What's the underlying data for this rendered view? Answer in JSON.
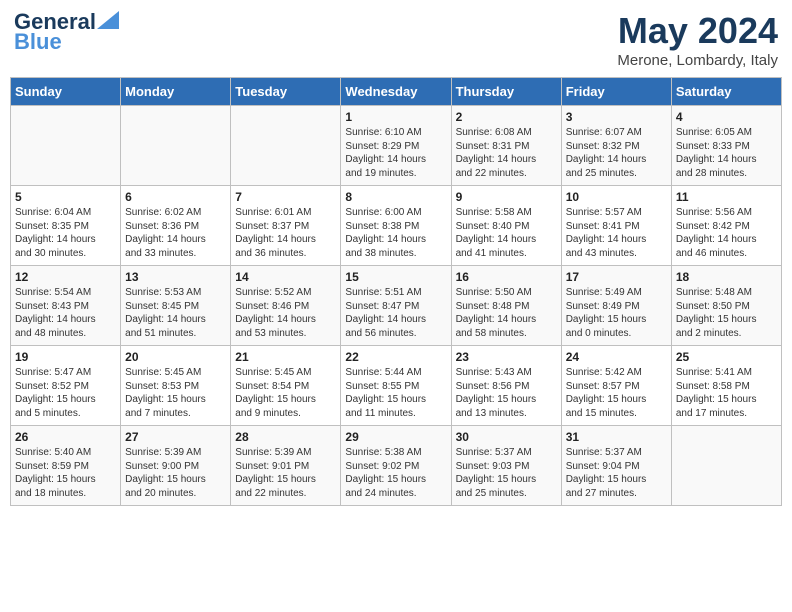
{
  "logo": {
    "general": "General",
    "blue": "Blue"
  },
  "title": "May 2024",
  "subtitle": "Merone, Lombardy, Italy",
  "days_of_week": [
    "Sunday",
    "Monday",
    "Tuesday",
    "Wednesday",
    "Thursday",
    "Friday",
    "Saturday"
  ],
  "weeks": [
    [
      {
        "day": "",
        "info": ""
      },
      {
        "day": "",
        "info": ""
      },
      {
        "day": "",
        "info": ""
      },
      {
        "day": "1",
        "info": "Sunrise: 6:10 AM\nSunset: 8:29 PM\nDaylight: 14 hours\nand 19 minutes."
      },
      {
        "day": "2",
        "info": "Sunrise: 6:08 AM\nSunset: 8:31 PM\nDaylight: 14 hours\nand 22 minutes."
      },
      {
        "day": "3",
        "info": "Sunrise: 6:07 AM\nSunset: 8:32 PM\nDaylight: 14 hours\nand 25 minutes."
      },
      {
        "day": "4",
        "info": "Sunrise: 6:05 AM\nSunset: 8:33 PM\nDaylight: 14 hours\nand 28 minutes."
      }
    ],
    [
      {
        "day": "5",
        "info": "Sunrise: 6:04 AM\nSunset: 8:35 PM\nDaylight: 14 hours\nand 30 minutes."
      },
      {
        "day": "6",
        "info": "Sunrise: 6:02 AM\nSunset: 8:36 PM\nDaylight: 14 hours\nand 33 minutes."
      },
      {
        "day": "7",
        "info": "Sunrise: 6:01 AM\nSunset: 8:37 PM\nDaylight: 14 hours\nand 36 minutes."
      },
      {
        "day": "8",
        "info": "Sunrise: 6:00 AM\nSunset: 8:38 PM\nDaylight: 14 hours\nand 38 minutes."
      },
      {
        "day": "9",
        "info": "Sunrise: 5:58 AM\nSunset: 8:40 PM\nDaylight: 14 hours\nand 41 minutes."
      },
      {
        "day": "10",
        "info": "Sunrise: 5:57 AM\nSunset: 8:41 PM\nDaylight: 14 hours\nand 43 minutes."
      },
      {
        "day": "11",
        "info": "Sunrise: 5:56 AM\nSunset: 8:42 PM\nDaylight: 14 hours\nand 46 minutes."
      }
    ],
    [
      {
        "day": "12",
        "info": "Sunrise: 5:54 AM\nSunset: 8:43 PM\nDaylight: 14 hours\nand 48 minutes."
      },
      {
        "day": "13",
        "info": "Sunrise: 5:53 AM\nSunset: 8:45 PM\nDaylight: 14 hours\nand 51 minutes."
      },
      {
        "day": "14",
        "info": "Sunrise: 5:52 AM\nSunset: 8:46 PM\nDaylight: 14 hours\nand 53 minutes."
      },
      {
        "day": "15",
        "info": "Sunrise: 5:51 AM\nSunset: 8:47 PM\nDaylight: 14 hours\nand 56 minutes."
      },
      {
        "day": "16",
        "info": "Sunrise: 5:50 AM\nSunset: 8:48 PM\nDaylight: 14 hours\nand 58 minutes."
      },
      {
        "day": "17",
        "info": "Sunrise: 5:49 AM\nSunset: 8:49 PM\nDaylight: 15 hours\nand 0 minutes."
      },
      {
        "day": "18",
        "info": "Sunrise: 5:48 AM\nSunset: 8:50 PM\nDaylight: 15 hours\nand 2 minutes."
      }
    ],
    [
      {
        "day": "19",
        "info": "Sunrise: 5:47 AM\nSunset: 8:52 PM\nDaylight: 15 hours\nand 5 minutes."
      },
      {
        "day": "20",
        "info": "Sunrise: 5:45 AM\nSunset: 8:53 PM\nDaylight: 15 hours\nand 7 minutes."
      },
      {
        "day": "21",
        "info": "Sunrise: 5:45 AM\nSunset: 8:54 PM\nDaylight: 15 hours\nand 9 minutes."
      },
      {
        "day": "22",
        "info": "Sunrise: 5:44 AM\nSunset: 8:55 PM\nDaylight: 15 hours\nand 11 minutes."
      },
      {
        "day": "23",
        "info": "Sunrise: 5:43 AM\nSunset: 8:56 PM\nDaylight: 15 hours\nand 13 minutes."
      },
      {
        "day": "24",
        "info": "Sunrise: 5:42 AM\nSunset: 8:57 PM\nDaylight: 15 hours\nand 15 minutes."
      },
      {
        "day": "25",
        "info": "Sunrise: 5:41 AM\nSunset: 8:58 PM\nDaylight: 15 hours\nand 17 minutes."
      }
    ],
    [
      {
        "day": "26",
        "info": "Sunrise: 5:40 AM\nSunset: 8:59 PM\nDaylight: 15 hours\nand 18 minutes."
      },
      {
        "day": "27",
        "info": "Sunrise: 5:39 AM\nSunset: 9:00 PM\nDaylight: 15 hours\nand 20 minutes."
      },
      {
        "day": "28",
        "info": "Sunrise: 5:39 AM\nSunset: 9:01 PM\nDaylight: 15 hours\nand 22 minutes."
      },
      {
        "day": "29",
        "info": "Sunrise: 5:38 AM\nSunset: 9:02 PM\nDaylight: 15 hours\nand 24 minutes."
      },
      {
        "day": "30",
        "info": "Sunrise: 5:37 AM\nSunset: 9:03 PM\nDaylight: 15 hours\nand 25 minutes."
      },
      {
        "day": "31",
        "info": "Sunrise: 5:37 AM\nSunset: 9:04 PM\nDaylight: 15 hours\nand 27 minutes."
      },
      {
        "day": "",
        "info": ""
      }
    ]
  ]
}
